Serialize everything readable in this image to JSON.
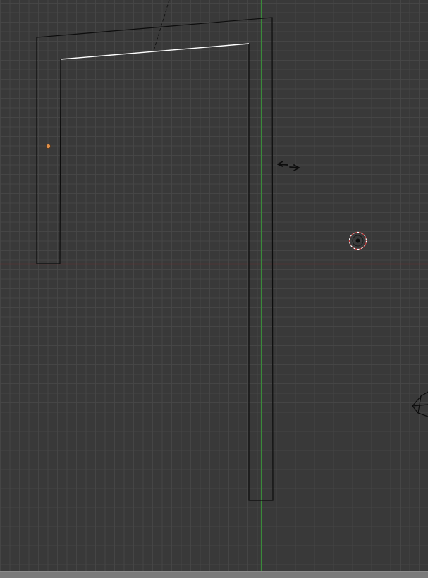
{
  "app": {
    "name": "3D viewport",
    "mode": "edit"
  },
  "colors": {
    "background": "#393939",
    "grid_line": "#484848",
    "x_axis": "#8a2f2f",
    "y_axis": "#3a8a3a",
    "mesh_edge": "#0d0d0d",
    "selected_edge": "#ffffff",
    "origin_point": "#e0904a",
    "bottom_strip": "#7a7a7a"
  },
  "icons": {
    "cursor": "resize-horizontal-icon",
    "scene_cursor": "3d-cursor-icon",
    "camera": "camera-icon",
    "origin": "object-origin-icon"
  }
}
